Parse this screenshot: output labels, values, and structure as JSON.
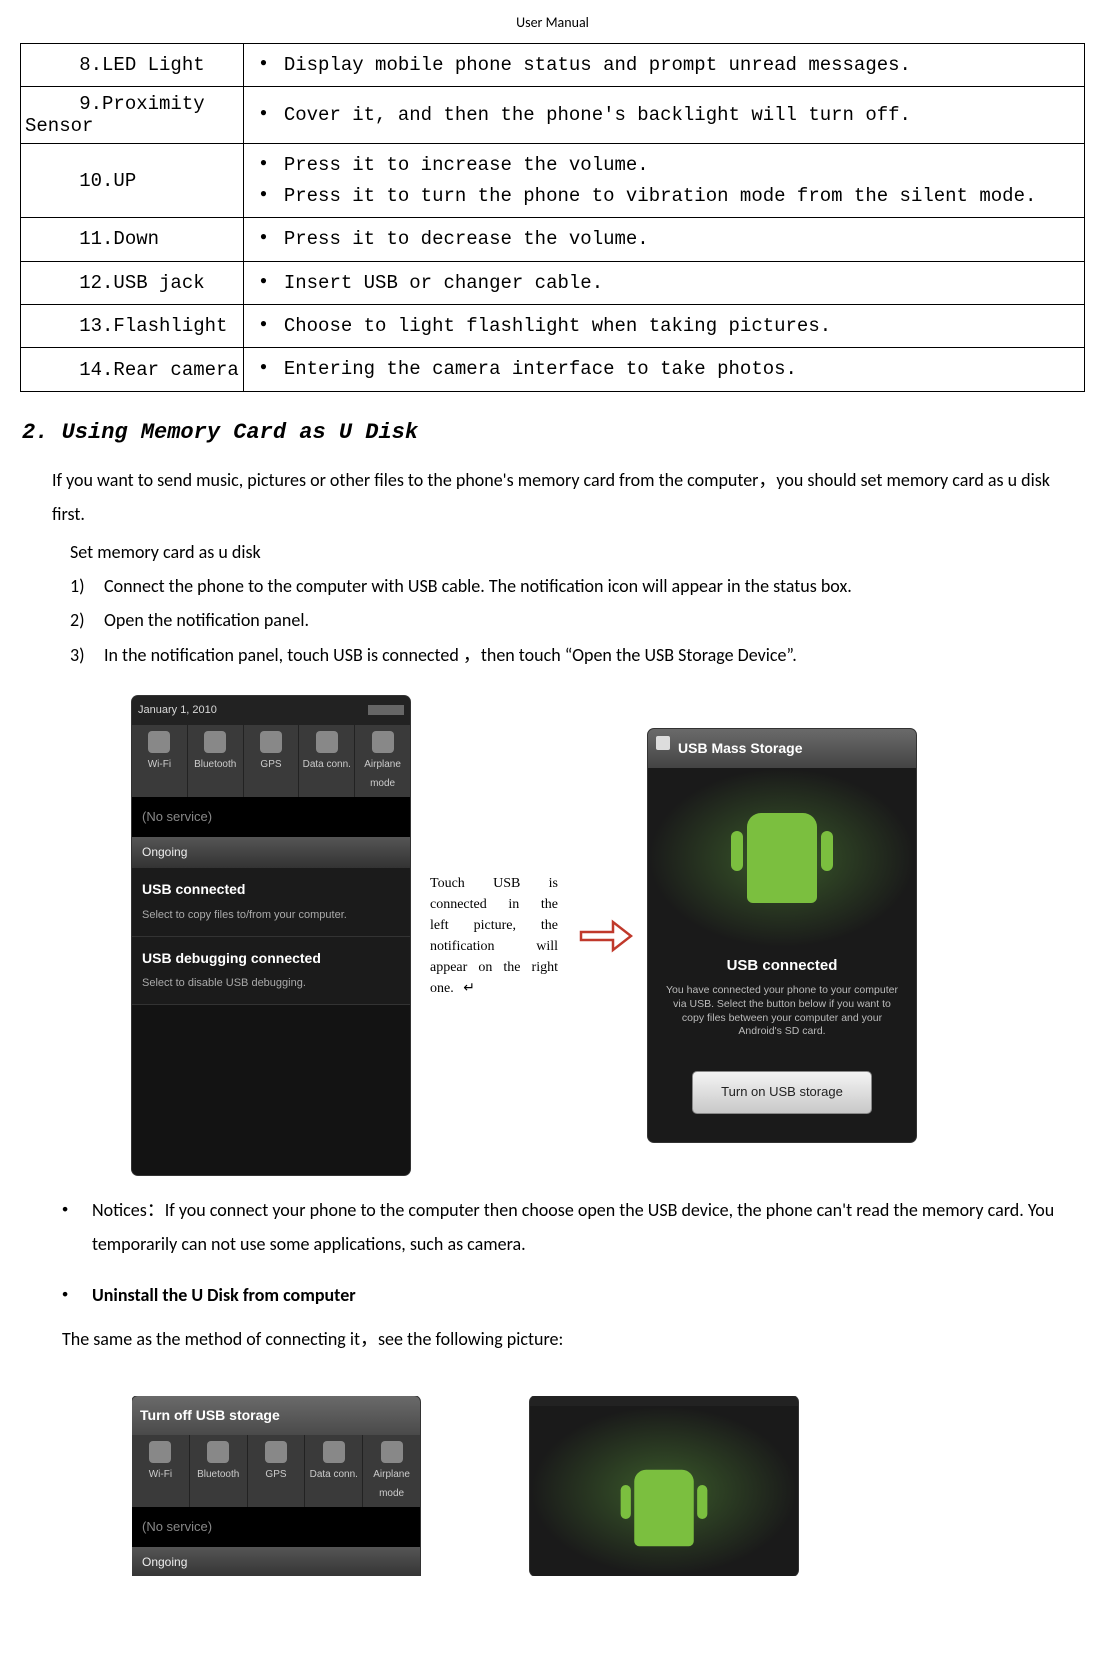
{
  "header": "User Manual",
  "table": {
    "rows": [
      {
        "label": "8.LED Light",
        "items": [
          "Display mobile phone status and prompt unread messages."
        ]
      },
      {
        "label": "9.Proximity Sensor",
        "multiline": true,
        "items": [
          "Cover it, and then the phone's backlight will turn off."
        ]
      },
      {
        "label": "10.UP",
        "items": [
          "Press it to increase the volume.",
          "Press it to turn the phone to vibration mode from the silent mode."
        ]
      },
      {
        "label": "11.Down",
        "items": [
          "Press it to decrease the volume."
        ]
      },
      {
        "label": "12.USB jack",
        "items": [
          "Insert USB or changer cable."
        ]
      },
      {
        "label": "13.Flashlight",
        "items": [
          "Choose to light flashlight when taking pictures."
        ]
      },
      {
        "label": "14.Rear camera",
        "items": [
          "Entering the camera interface to take photos."
        ]
      }
    ]
  },
  "section_title": "2. Using Memory Card as U Disk",
  "intro": "If you want to send music, pictures or other files to the phone's memory card from the computer，you should set memory card as u disk first.",
  "sub_heading": "Set memory card as u disk",
  "steps": [
    "Connect the phone to the computer with USB cable. The notification icon will appear in the status box.",
    "Open the notification panel.",
    "In the notification panel, touch USB is connected ，then touch “Open the USB Storage Device”."
  ],
  "mid_note": "Touch USB is connected in the left picture, the notification will appear on the right one. ↵",
  "phone_left": {
    "date": "January 1, 2010",
    "toggles": [
      "Wi-Fi",
      "Bluetooth",
      "GPS",
      "Data conn.",
      "Airplane mode"
    ],
    "noservice": "(No service)",
    "ongoing_hdr": "Ongoing",
    "item1_title": "USB connected",
    "item1_sub": "Select to copy files to/from your computer.",
    "item2_title": "USB debugging connected",
    "item2_sub": "Select to disable USB debugging."
  },
  "phone_right": {
    "title": "USB Mass Storage",
    "msg_title": "USB connected",
    "msg_sub": "You have connected your phone to your computer via USB. Select the button below if you want to copy files between your computer and your Android's SD card.",
    "button": "Turn on USB storage"
  },
  "notice": "Notices：If you connect your phone to the computer then choose open the USB device, the phone can't read the memory card. You temporarily can not use some applications, such as camera.",
  "uninstall_heading": "Uninstall the U Disk from computer",
  "uninstall_text": "The same as the method of connecting it，see the following picture:",
  "phone_left2": {
    "title": "Turn off USB storage",
    "toggles": [
      "Wi-Fi",
      "Bluetooth",
      "GPS",
      "Data conn.",
      "Airplane mode"
    ],
    "noservice": "(No service)",
    "ongoing_hdr": "Ongoing"
  }
}
